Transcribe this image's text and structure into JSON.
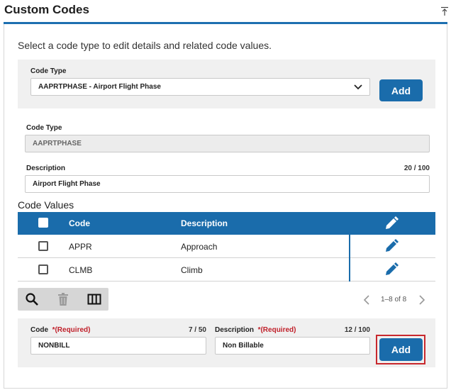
{
  "page": {
    "title": "Custom Codes",
    "instructions": "Select a code type to edit details and related code values."
  },
  "code_type_select": {
    "label": "Code Type",
    "value": "AAPRTPHASE - Airport Flight Phase",
    "add_label": "Add"
  },
  "details": {
    "code_type_label": "Code Type",
    "code_type_value": "AAPRTPHASE",
    "description_label": "Description",
    "description_counter": "20 / 100",
    "description_value": "Airport Flight Phase"
  },
  "code_values": {
    "title": "Code Values",
    "columns": {
      "code": "Code",
      "description": "Description"
    },
    "rows": [
      {
        "code": "APPR",
        "description": "Approach"
      },
      {
        "code": "CLMB",
        "description": "Climb"
      }
    ]
  },
  "toolbar": {
    "icons": [
      "search-icon",
      "trash-icon",
      "columns-icon"
    ]
  },
  "pagination": {
    "range": "1–8 of 8"
  },
  "new_value_form": {
    "code_label": "Code",
    "code_required": "*(Required)",
    "code_counter": "7 / 50",
    "code_value": "NONBILL",
    "description_label": "Description",
    "description_required": "*(Required)",
    "description_counter": "12 / 100",
    "description_value": "Non Billable",
    "add_label": "Add"
  },
  "colors": {
    "primary": "#1a6cab",
    "required": "#c0202a",
    "focus_ring": "#c8282e"
  }
}
